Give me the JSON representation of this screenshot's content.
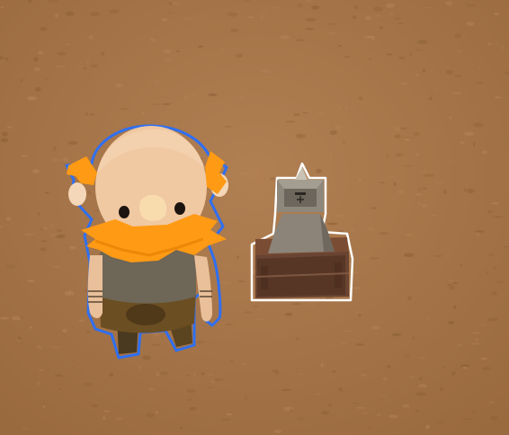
{
  "scene": {
    "ground": {
      "base_color": "#a9784a",
      "light_color": "#b5845a",
      "dark_color": "#8d5f37"
    },
    "characters": [
      {
        "name": "dwarf",
        "selected": true,
        "outline_color": "#2f6ff2",
        "hair_beard_color": "#ff9a14",
        "skin_color": "#f0c8a2",
        "shirt_color": "#6e6656",
        "pants_color": "#6b4e22"
      }
    ],
    "objects": [
      {
        "name": "stone-anvil-on-crate",
        "highlighted": true,
        "outline_color": "#ffffff",
        "stone_color": "#8c8478",
        "crate_color": "#6a4432"
      }
    ]
  }
}
